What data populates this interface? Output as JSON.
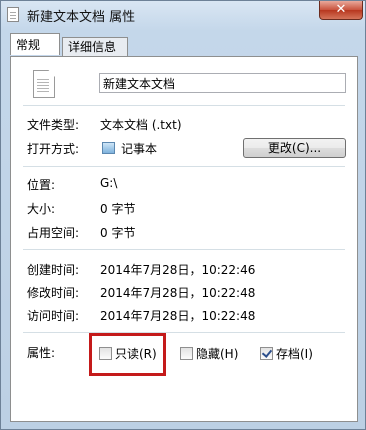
{
  "window": {
    "title": "新建文本文档 属性",
    "close_label": "✕"
  },
  "tabs": [
    {
      "label": "常规",
      "active": true
    },
    {
      "label": "详细信息",
      "active": false
    }
  ],
  "file": {
    "name": "新建文本文档"
  },
  "type_section": {
    "file_type_label": "文件类型:",
    "file_type_value": "文本文档 (.txt)",
    "open_with_label": "打开方式:",
    "open_with_value": "记事本",
    "change_button": "更改(C)..."
  },
  "location_section": {
    "location_label": "位置:",
    "location_value": "G:\\",
    "size_label": "大小:",
    "size_value": "0 字节",
    "size_on_disk_label": "占用空间:",
    "size_on_disk_value": "0 字节"
  },
  "dates_section": {
    "created_label": "创建时间:",
    "created_value": "2014年7月28日，10:22:46",
    "modified_label": "修改时间:",
    "modified_value": "2014年7月28日，10:22:48",
    "accessed_label": "访问时间:",
    "accessed_value": "2014年7月28日，10:22:48"
  },
  "attributes": {
    "label": "属性:",
    "readonly": {
      "label": "只读(R)",
      "checked": false
    },
    "hidden": {
      "label": "隐藏(H)",
      "checked": false
    },
    "archive": {
      "label": "存档(I)",
      "checked": true
    }
  },
  "colors": {
    "highlight": "#c41a1a",
    "window_frame": "#bcd0e4",
    "close_button": "#c8523c"
  }
}
